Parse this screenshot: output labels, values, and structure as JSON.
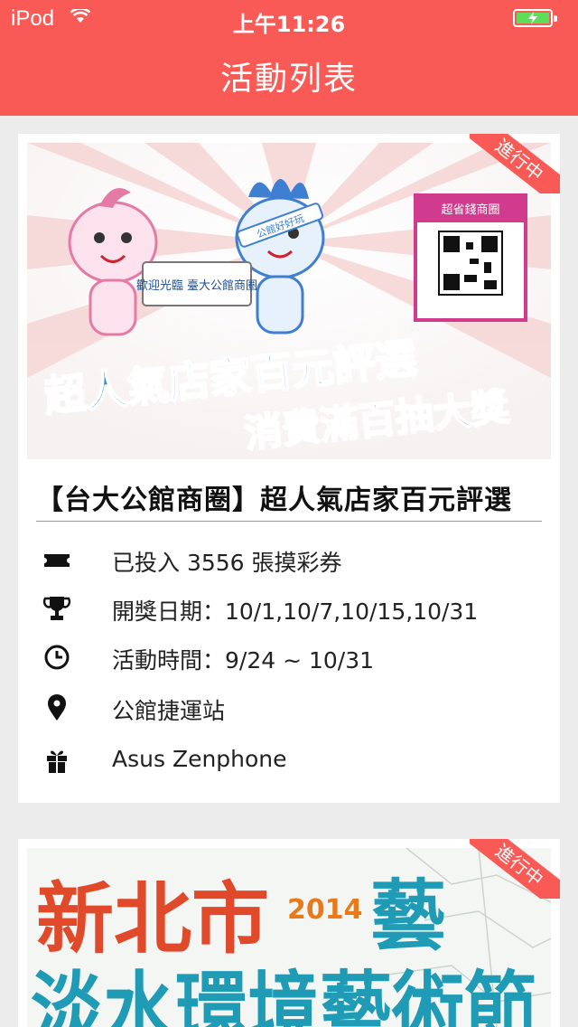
{
  "status_bar": {
    "carrier": "iPod",
    "time": "上午11:26"
  },
  "header": {
    "title": "活動列表"
  },
  "colors": {
    "brand": "#fa5a55",
    "background": "#ececec"
  },
  "events": [
    {
      "badge": "進行中",
      "banner_text": {
        "welcome_sign": "歡迎光臨 臺大公館商圈",
        "sash": "公館好好玩",
        "qr_header": "超省錢商圈",
        "line1": "超人氣店家百元評選",
        "line2": "消費滿百抽大獎"
      },
      "title": "【台大公館商圈】超人氣店家百元評選",
      "details": [
        {
          "icon": "ticket-icon",
          "text": "已投入 3556 張摸彩券"
        },
        {
          "icon": "trophy-icon",
          "text": "開獎日期：10/1,10/7,10/15,10/31"
        },
        {
          "icon": "clock-icon",
          "text": "活動時間：9/24 ~ 10/31"
        },
        {
          "icon": "location-pin-icon",
          "text": "公館捷運站"
        },
        {
          "icon": "gift-icon",
          "text": "Asus Zenphone"
        }
      ]
    },
    {
      "badge": "進行中",
      "banner_text": {
        "line1": "新北市",
        "year": "2014",
        "line1b": "藝",
        "line2": "淡水環境藝術節"
      }
    }
  ]
}
